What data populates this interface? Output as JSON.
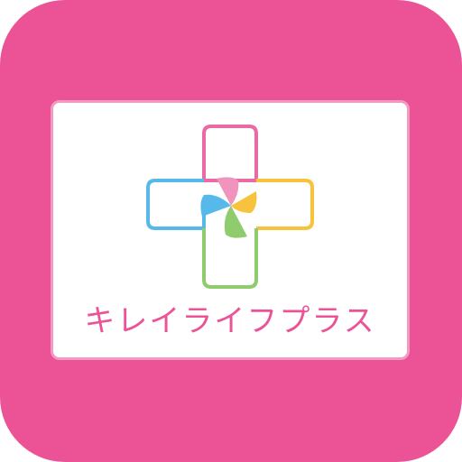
{
  "brand": {
    "name": "キレイライフプラス"
  },
  "logo": {
    "icon": "four-color-plus-logo",
    "colors": {
      "pink": "#ec5296",
      "light_pink": "#f093bd",
      "blue": "#56b9ea",
      "yellow": "#f8c33c",
      "green": "#8fcc6e",
      "card_border": "#f29bc1",
      "background": "#ec5296"
    }
  }
}
